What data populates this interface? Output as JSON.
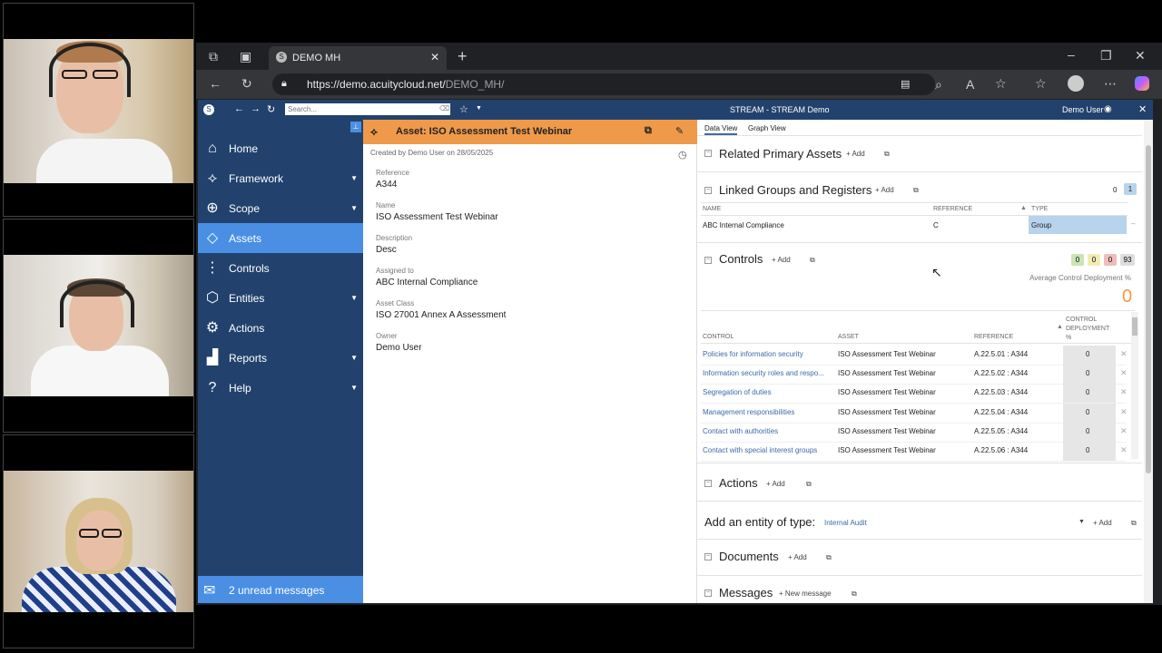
{
  "participants": [
    {
      "id": "p1",
      "label": "participant-1"
    },
    {
      "id": "p2",
      "label": "participant-2"
    },
    {
      "id": "p3",
      "label": "participant-3"
    }
  ],
  "browser": {
    "tab_title": "DEMO MH",
    "url_host": "https://demo.acuitycloud.net/",
    "url_path": "DEMO_MH/"
  },
  "app": {
    "header_title": "STREAM - STREAM Demo",
    "user_name": "Demo User",
    "search_placeholder": "Search..."
  },
  "sidebar": {
    "items": [
      {
        "label": "Home",
        "icon": "home-icon",
        "glyph": "⌂",
        "caret": false
      },
      {
        "label": "Framework",
        "icon": "framework-icon",
        "glyph": "⟡",
        "caret": true
      },
      {
        "label": "Scope",
        "icon": "target-icon",
        "glyph": "⊕",
        "caret": true
      },
      {
        "label": "Assets",
        "icon": "diamond-icon",
        "glyph": "◇",
        "caret": false
      },
      {
        "label": "Controls",
        "icon": "sliders-icon",
        "glyph": "⋮",
        "caret": false
      },
      {
        "label": "Entities",
        "icon": "cube-icon",
        "glyph": "⬡",
        "caret": true
      },
      {
        "label": "Actions",
        "icon": "actions-icon",
        "glyph": "⚙",
        "caret": false
      },
      {
        "label": "Reports",
        "icon": "chart-icon",
        "glyph": "▟",
        "caret": true
      },
      {
        "label": "Help",
        "icon": "help-icon",
        "glyph": "?",
        "caret": true
      }
    ],
    "messages": "2 unread messages"
  },
  "detail": {
    "title": "Asset: ISO Assessment Test Webinar",
    "created_by": "Created by Demo User on 28/05/2025",
    "fields": [
      {
        "label": "Reference",
        "value": "A344"
      },
      {
        "label": "Name",
        "value": "ISO Assessment Test Webinar"
      },
      {
        "label": "Description",
        "value": "Desc"
      },
      {
        "label": "Assigned to",
        "value": "ABC Internal Compliance"
      },
      {
        "label": "Asset Class",
        "value": "ISO 27001 Annex A Assessment"
      },
      {
        "label": "Owner",
        "value": "Demo User"
      }
    ]
  },
  "right": {
    "tabs": [
      "Data View",
      "Graph View"
    ],
    "add_label": "+ Add",
    "related": {
      "title": "Related Primary Assets"
    },
    "linked": {
      "title": "Linked Groups and Registers",
      "count_a": "0",
      "count_b": "1",
      "headers": [
        "NAME",
        "REFERENCE",
        "TYPE"
      ],
      "rows": [
        {
          "name": "ABC Internal Compliance",
          "reference": "C",
          "type": "Group"
        }
      ]
    },
    "controls": {
      "title": "Controls",
      "badges": [
        "0",
        "0",
        "0",
        "93"
      ],
      "avg_label": "Average Control Deployment %",
      "avg_value": "0",
      "headers": [
        "CONTROL",
        "ASSET",
        "REFERENCE",
        "CONTROL DEPLOYMENT %"
      ],
      "rows": [
        {
          "control": "Policies for information security",
          "asset": "ISO Assessment Test Webinar",
          "reference": "A.22.5.01 : A344",
          "deploy": "0"
        },
        {
          "control": "Information security roles and respo...",
          "asset": "ISO Assessment Test Webinar",
          "reference": "A.22.5.02 : A344",
          "deploy": "0"
        },
        {
          "control": "Segregation of duties",
          "asset": "ISO Assessment Test Webinar",
          "reference": "A.22.5.03 : A344",
          "deploy": "0"
        },
        {
          "control": "Management responsibilities",
          "asset": "ISO Assessment Test Webinar",
          "reference": "A.22.5.04 : A344",
          "deploy": "0"
        },
        {
          "control": "Contact with authorities",
          "asset": "ISO Assessment Test Webinar",
          "reference": "A.22.5.05 : A344",
          "deploy": "0"
        },
        {
          "control": "Contact with special interest groups",
          "asset": "ISO Assessment Test Webinar",
          "reference": "A.22.5.06 : A344",
          "deploy": "0"
        }
      ]
    },
    "actions": {
      "title": "Actions"
    },
    "entity": {
      "title": "Add an entity of type:",
      "selected": "Internal Audit"
    },
    "documents": {
      "title": "Documents"
    },
    "messages": {
      "title": "Messages",
      "new_label": "+ New message"
    }
  },
  "colors": {
    "accent": "#ef9a4a",
    "nav_bg": "#22426d",
    "nav_active": "#4a8fe4"
  }
}
